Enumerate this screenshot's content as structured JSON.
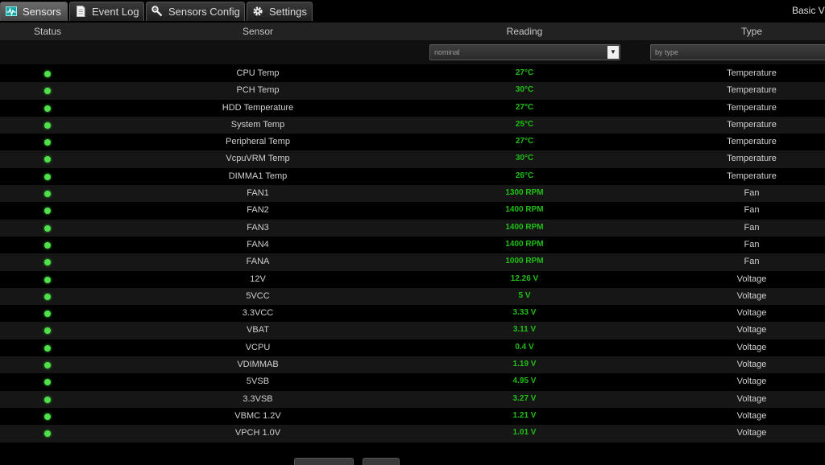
{
  "tabs": [
    {
      "label": "Sensors",
      "icon": "sensors-chart-icon",
      "active": true
    },
    {
      "label": "Event Log",
      "icon": "document-icon",
      "active": false
    },
    {
      "label": "Sensors Config",
      "icon": "wrench-icon",
      "active": false
    },
    {
      "label": "Settings",
      "icon": "gear-icon",
      "active": false
    }
  ],
  "brand": "Basic Vi",
  "columns": {
    "status": "Status",
    "sensor": "Sensor",
    "reading": "Reading",
    "type": "Type"
  },
  "filters": {
    "reading": "nominal",
    "type": "by type"
  },
  "rows": [
    {
      "sensor": "CPU Temp",
      "reading": "27°C",
      "type": "Temperature"
    },
    {
      "sensor": "PCH Temp",
      "reading": "30°C",
      "type": "Temperature"
    },
    {
      "sensor": "HDD Temperature",
      "reading": "27°C",
      "type": "Temperature"
    },
    {
      "sensor": "System Temp",
      "reading": "25°C",
      "type": "Temperature"
    },
    {
      "sensor": "Peripheral Temp",
      "reading": "27°C",
      "type": "Temperature"
    },
    {
      "sensor": "VcpuVRM Temp",
      "reading": "30°C",
      "type": "Temperature"
    },
    {
      "sensor": "DIMMA1 Temp",
      "reading": "26°C",
      "type": "Temperature"
    },
    {
      "sensor": "FAN1",
      "reading": "1300 RPM",
      "type": "Fan"
    },
    {
      "sensor": "FAN2",
      "reading": "1400 RPM",
      "type": "Fan"
    },
    {
      "sensor": "FAN3",
      "reading": "1400 RPM",
      "type": "Fan"
    },
    {
      "sensor": "FAN4",
      "reading": "1400 RPM",
      "type": "Fan"
    },
    {
      "sensor": "FANA",
      "reading": "1000 RPM",
      "type": "Fan"
    },
    {
      "sensor": "12V",
      "reading": "12.26 V",
      "type": "Voltage"
    },
    {
      "sensor": "5VCC",
      "reading": "5 V",
      "type": "Voltage"
    },
    {
      "sensor": "3.3VCC",
      "reading": "3.33 V",
      "type": "Voltage"
    },
    {
      "sensor": "VBAT",
      "reading": "3.11 V",
      "type": "Voltage"
    },
    {
      "sensor": "VCPU",
      "reading": "0.4 V",
      "type": "Voltage"
    },
    {
      "sensor": "VDIMMAB",
      "reading": "1.19 V",
      "type": "Voltage"
    },
    {
      "sensor": "5VSB",
      "reading": "4.95 V",
      "type": "Voltage"
    },
    {
      "sensor": "3.3VSB",
      "reading": "3.27 V",
      "type": "Voltage"
    },
    {
      "sensor": "VBMC 1.2V",
      "reading": "1.21 V",
      "type": "Voltage"
    },
    {
      "sensor": "VPCH 1.0V",
      "reading": "1.01 V",
      "type": "Voltage"
    }
  ],
  "status_color": "#4fe04a",
  "reading_color": "#1fbf14"
}
